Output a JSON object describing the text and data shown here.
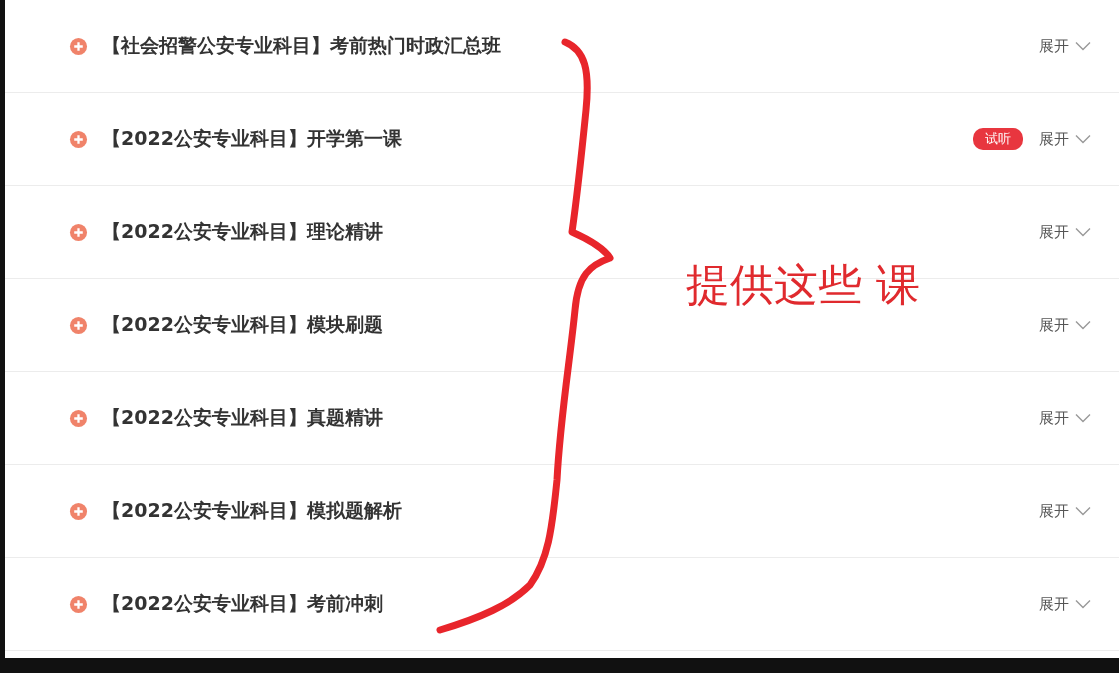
{
  "courses": [
    {
      "title": "【社会招警公安专业科目】考前热门时政汇总班",
      "expand_label": "展开"
    },
    {
      "title": "【2022公安专业科目】开学第一课",
      "badge": "试听",
      "expand_label": "展开"
    },
    {
      "title": "【2022公安专业科目】理论精讲",
      "expand_label": "展开"
    },
    {
      "title": "【2022公安专业科目】模块刷题",
      "expand_label": "展开"
    },
    {
      "title": "【2022公安专业科目】真题精讲",
      "expand_label": "展开"
    },
    {
      "title": "【2022公安专业科目】模拟题解析",
      "expand_label": "展开"
    },
    {
      "title": "【2022公安专业科目】考前冲刺",
      "expand_label": "展开"
    }
  ],
  "annotation": {
    "text": "提供这些 课"
  }
}
